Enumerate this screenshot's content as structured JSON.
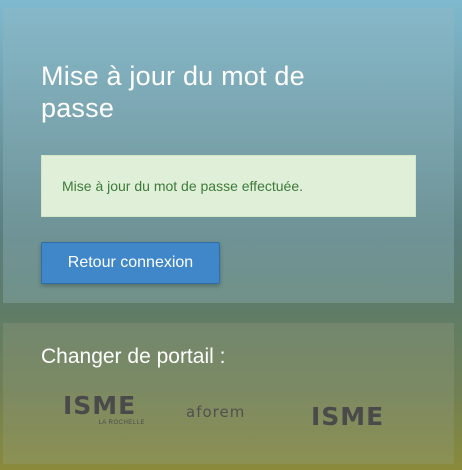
{
  "update": {
    "title": "Mise à jour du mot de passe",
    "alert": "Mise à jour du mot de passe effectuée.",
    "button": "Retour connexion"
  },
  "portal": {
    "title": "Changer de portail :",
    "logos": [
      {
        "name": "ISME",
        "subtitle": "LA ROCHELLE"
      },
      {
        "name": "aforem"
      },
      {
        "name": "ISME"
      }
    ]
  },
  "colors": {
    "button": "#3f87c9",
    "alert_bg": "#e0f0d8",
    "alert_text": "#3d7a3a"
  }
}
